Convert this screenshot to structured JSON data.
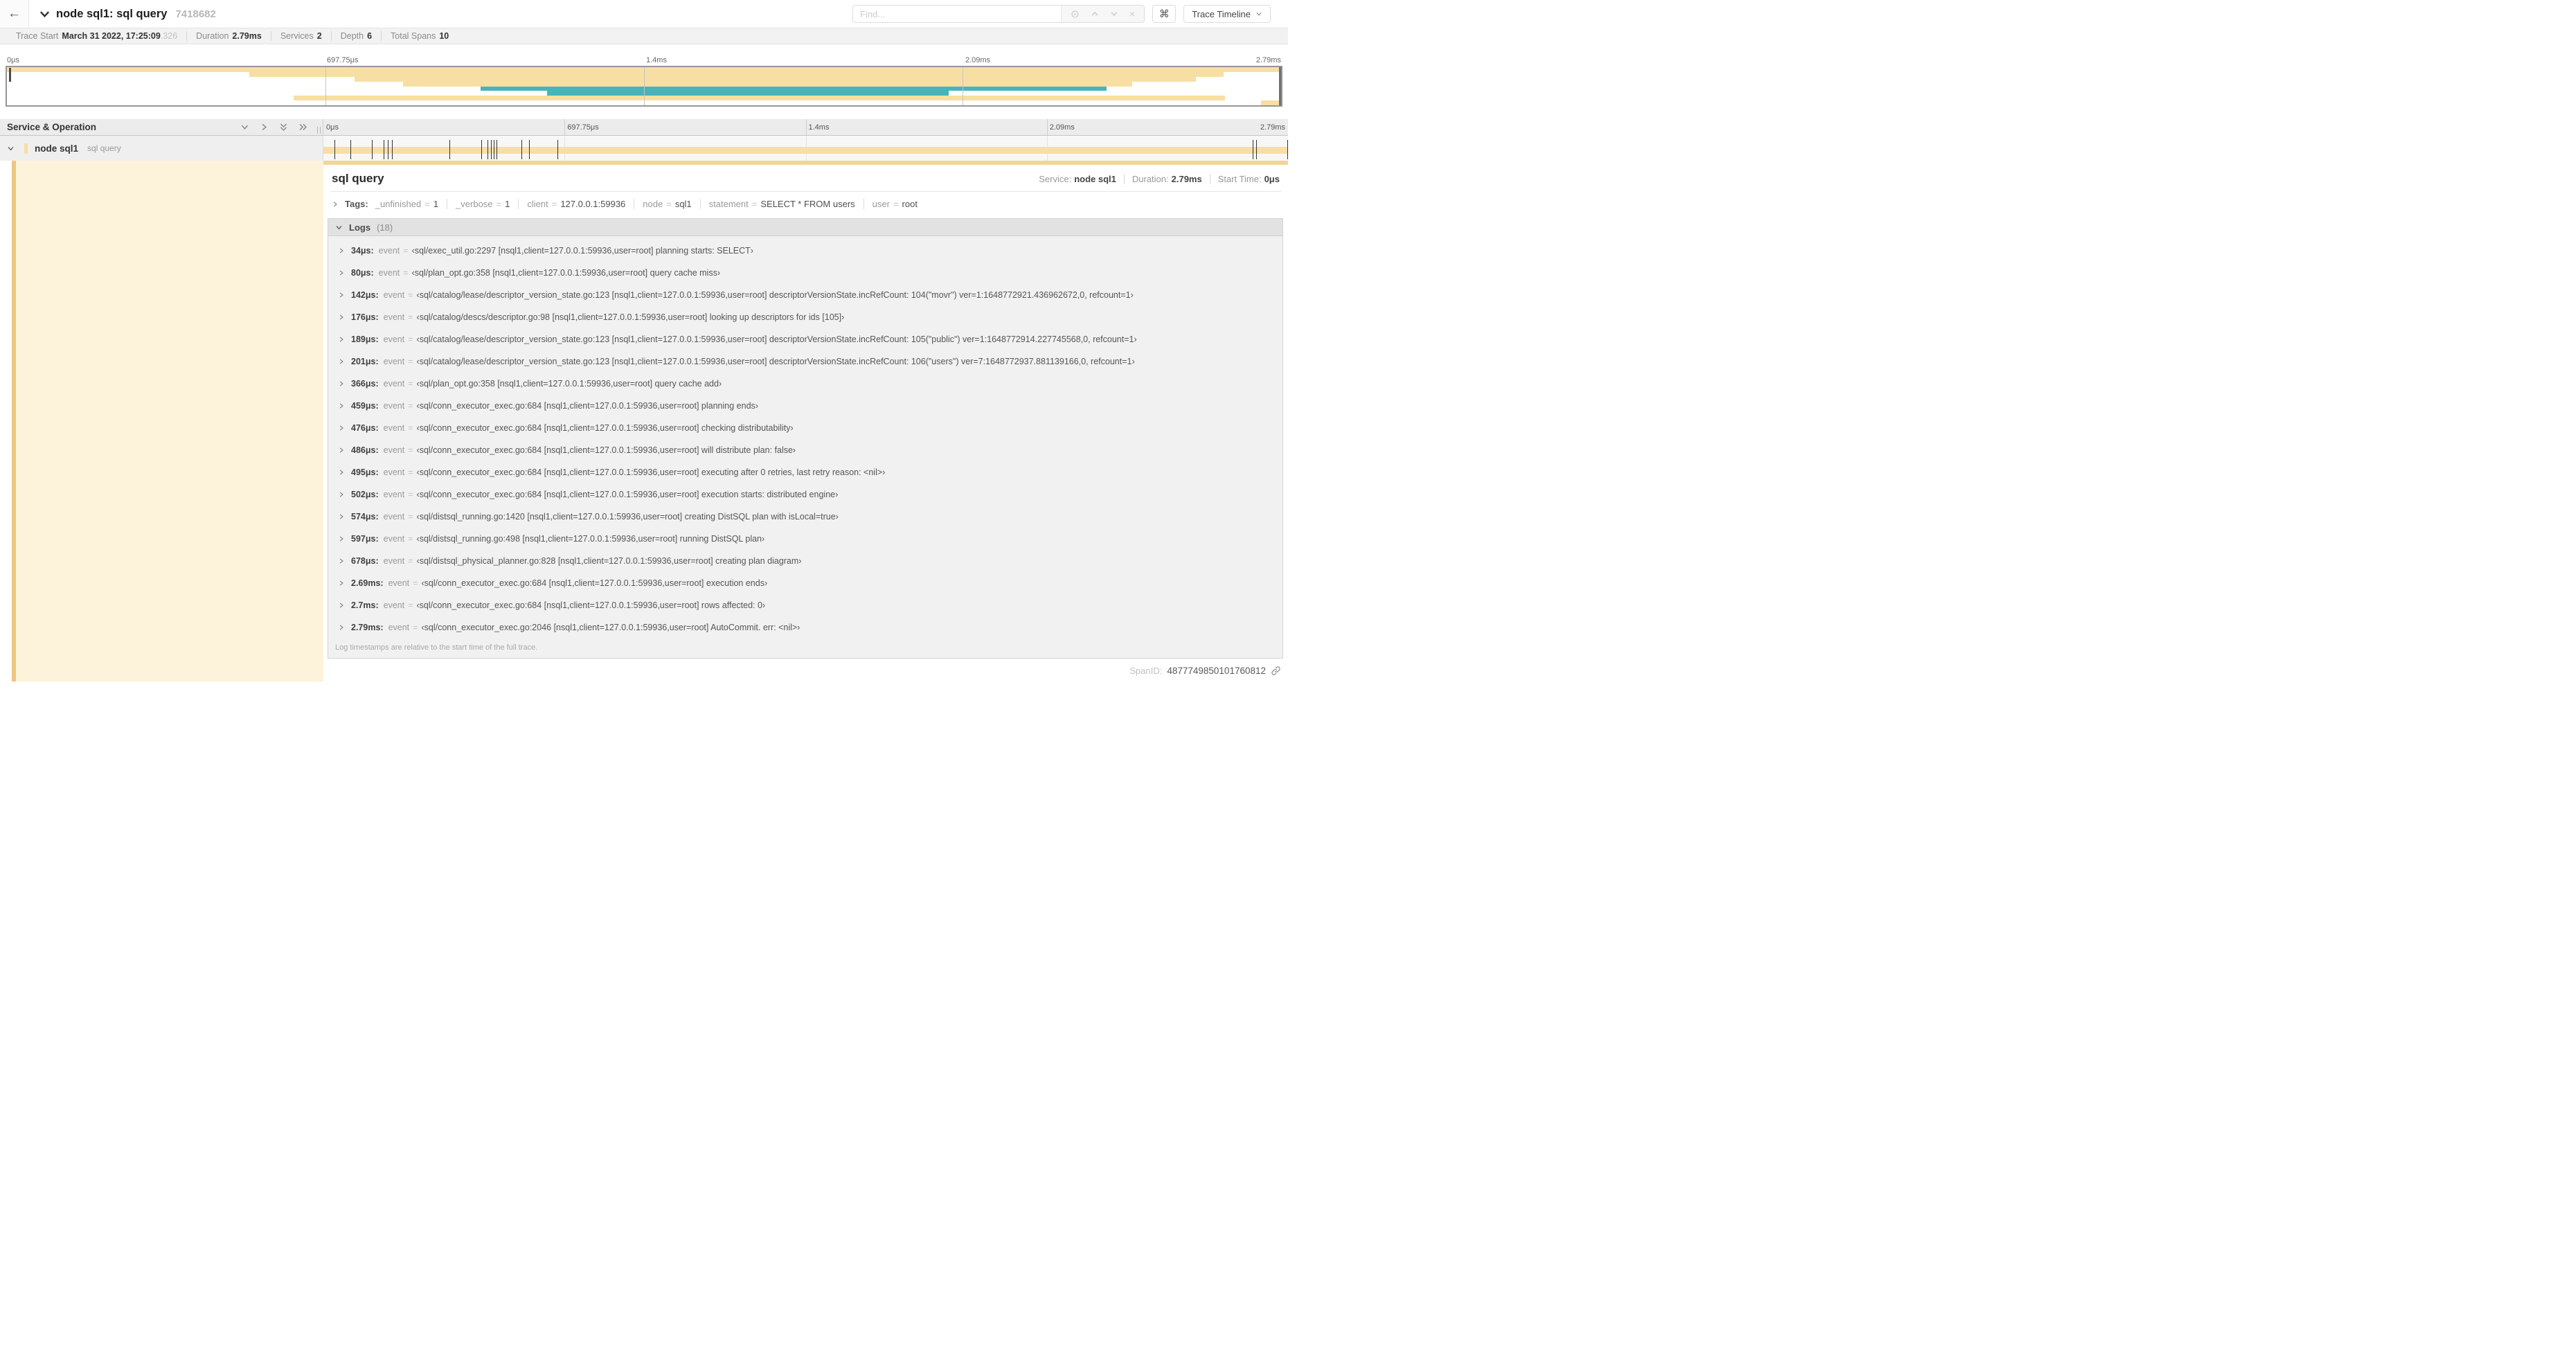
{
  "colors": {
    "tan": "#f7dfa3",
    "tan_dark": "#ecc87f",
    "accent": "#f3d694",
    "cream": "#fcf3da",
    "teal": "#47b4bc"
  },
  "header": {
    "title": "node sql1: sql query",
    "trace_id": "7418682",
    "find_placeholder": "Find...",
    "shortcut_label": "⌘",
    "view_label": "Trace Timeline"
  },
  "trace_info": {
    "items": [
      {
        "label": "Trace Start",
        "value": "March 31 2022, 17:25:09",
        "suffix": ".326"
      },
      {
        "label": "Duration",
        "value": "2.79ms",
        "suffix": ""
      },
      {
        "label": "Services",
        "value": "2",
        "suffix": ""
      },
      {
        "label": "Depth",
        "value": "6",
        "suffix": ""
      },
      {
        "label": "Total Spans",
        "value": "10",
        "suffix": ""
      }
    ]
  },
  "timeline": {
    "duration_us": 2790,
    "ticks": [
      "0μs",
      "697.75μs",
      "1.4ms",
      "2.09ms",
      "2.79ms"
    ],
    "minimap_rows": [
      {
        "start_pct": 0,
        "end_pct": 100,
        "color": "tan"
      },
      {
        "start_pct": 19,
        "end_pct": 95.5,
        "color": "tan"
      },
      {
        "start_pct": 27.3,
        "end_pct": 93.3,
        "color": "tan"
      },
      {
        "start_pct": 31.1,
        "end_pct": 88.3,
        "color": "tan"
      },
      {
        "start_pct": 37.2,
        "end_pct": 86.3,
        "color": "teal"
      },
      {
        "start_pct": 42.4,
        "end_pct": 73.9,
        "color": "teal"
      },
      {
        "start_pct": 22.5,
        "end_pct": 95.6,
        "color": "tan"
      },
      {
        "start_pct": 98.4,
        "end_pct": 99.9,
        "color": "tan"
      }
    ]
  },
  "span_table": {
    "header_label": "Service & Operation"
  },
  "span_row": {
    "service": "node sql1",
    "operation": "sql query"
  },
  "detail": {
    "title": "sql query",
    "meta": [
      {
        "label": "Service:",
        "value": "node sql1"
      },
      {
        "label": "Duration:",
        "value": "2.79ms"
      },
      {
        "label": "Start Time:",
        "value": "0μs"
      }
    ],
    "tags": {
      "label": "Tags:",
      "items": [
        {
          "key": "_unfinished",
          "value": "1"
        },
        {
          "key": "_verbose",
          "value": "1"
        },
        {
          "key": "client",
          "value": "127.0.0.1:59936"
        },
        {
          "key": "node",
          "value": "sql1"
        },
        {
          "key": "statement",
          "value": "SELECT * FROM users"
        },
        {
          "key": "user",
          "value": "root"
        }
      ]
    },
    "logs": {
      "label": "Logs",
      "count_label": "(18)",
      "field": "event",
      "rows": [
        {
          "time": "34μs:",
          "us": 34,
          "field": "event",
          "value": "‹sql/exec_util.go:2297 [nsql1,client=127.0.0.1:59936,user=root] planning starts: SELECT›"
        },
        {
          "time": "80μs:",
          "us": 80,
          "field": "event",
          "value": "‹sql/plan_opt.go:358 [nsql1,client=127.0.0.1:59936,user=root] query cache miss›"
        },
        {
          "time": "142μs:",
          "us": 142,
          "field": "event",
          "value": "‹sql/catalog/lease/descriptor_version_state.go:123 [nsql1,client=127.0.0.1:59936,user=root] descriptorVersionState.incRefCount: 104(\"movr\") ver=1:1648772921.436962672,0, refcount=1›"
        },
        {
          "time": "176μs:",
          "us": 176,
          "field": "event",
          "value": "‹sql/catalog/descs/descriptor.go:98 [nsql1,client=127.0.0.1:59936,user=root] looking up descriptors for ids [105]›"
        },
        {
          "time": "189μs:",
          "us": 189,
          "field": "event",
          "value": "‹sql/catalog/lease/descriptor_version_state.go:123 [nsql1,client=127.0.0.1:59936,user=root] descriptorVersionState.incRefCount: 105(\"public\") ver=1:1648772914.227745568,0, refcount=1›"
        },
        {
          "time": "201μs:",
          "us": 201,
          "field": "event",
          "value": "‹sql/catalog/lease/descriptor_version_state.go:123 [nsql1,client=127.0.0.1:59936,user=root] descriptorVersionState.incRefCount: 106(\"users\") ver=7:1648772937.881139166,0, refcount=1›"
        },
        {
          "time": "366μs:",
          "us": 366,
          "field": "event",
          "value": "‹sql/plan_opt.go:358 [nsql1,client=127.0.0.1:59936,user=root] query cache add›"
        },
        {
          "time": "459μs:",
          "us": 459,
          "field": "event",
          "value": "‹sql/conn_executor_exec.go:684 [nsql1,client=127.0.0.1:59936,user=root] planning ends›"
        },
        {
          "time": "476μs:",
          "us": 476,
          "field": "event",
          "value": "‹sql/conn_executor_exec.go:684 [nsql1,client=127.0.0.1:59936,user=root] checking distributability›"
        },
        {
          "time": "486μs:",
          "us": 486,
          "field": "event",
          "value": "‹sql/conn_executor_exec.go:684 [nsql1,client=127.0.0.1:59936,user=root] will distribute plan: false›"
        },
        {
          "time": "495μs:",
          "us": 495,
          "field": "event",
          "value": "‹sql/conn_executor_exec.go:684 [nsql1,client=127.0.0.1:59936,user=root] executing after 0 retries, last retry reason: <nil>›"
        },
        {
          "time": "502μs:",
          "us": 502,
          "field": "event",
          "value": "‹sql/conn_executor_exec.go:684 [nsql1,client=127.0.0.1:59936,user=root] execution starts: distributed engine›"
        },
        {
          "time": "574μs:",
          "us": 574,
          "field": "event",
          "value": "‹sql/distsql_running.go:1420 [nsql1,client=127.0.0.1:59936,user=root] creating DistSQL plan with isLocal=true›"
        },
        {
          "time": "597μs:",
          "us": 597,
          "field": "event",
          "value": "‹sql/distsql_running.go:498 [nsql1,client=127.0.0.1:59936,user=root] running DistSQL plan›"
        },
        {
          "time": "678μs:",
          "us": 678,
          "field": "event",
          "value": "‹sql/distsql_physical_planner.go:828 [nsql1,client=127.0.0.1:59936,user=root] creating plan diagram›"
        },
        {
          "time": "2.69ms:",
          "us": 2690,
          "field": "event",
          "value": "‹sql/conn_executor_exec.go:684 [nsql1,client=127.0.0.1:59936,user=root] execution ends›"
        },
        {
          "time": "2.7ms:",
          "us": 2700,
          "field": "event",
          "value": "‹sql/conn_executor_exec.go:684 [nsql1,client=127.0.0.1:59936,user=root] rows affected: 0›"
        },
        {
          "time": "2.79ms:",
          "us": 2790,
          "field": "event",
          "value": "‹sql/conn_executor_exec.go:2046 [nsql1,client=127.0.0.1:59936,user=root] AutoCommit. err: <nil>›"
        }
      ],
      "footer": "Log timestamps are relative to the start time of the full trace."
    },
    "span_id": {
      "label": "SpanID:",
      "value": "4877749850101760812"
    }
  }
}
